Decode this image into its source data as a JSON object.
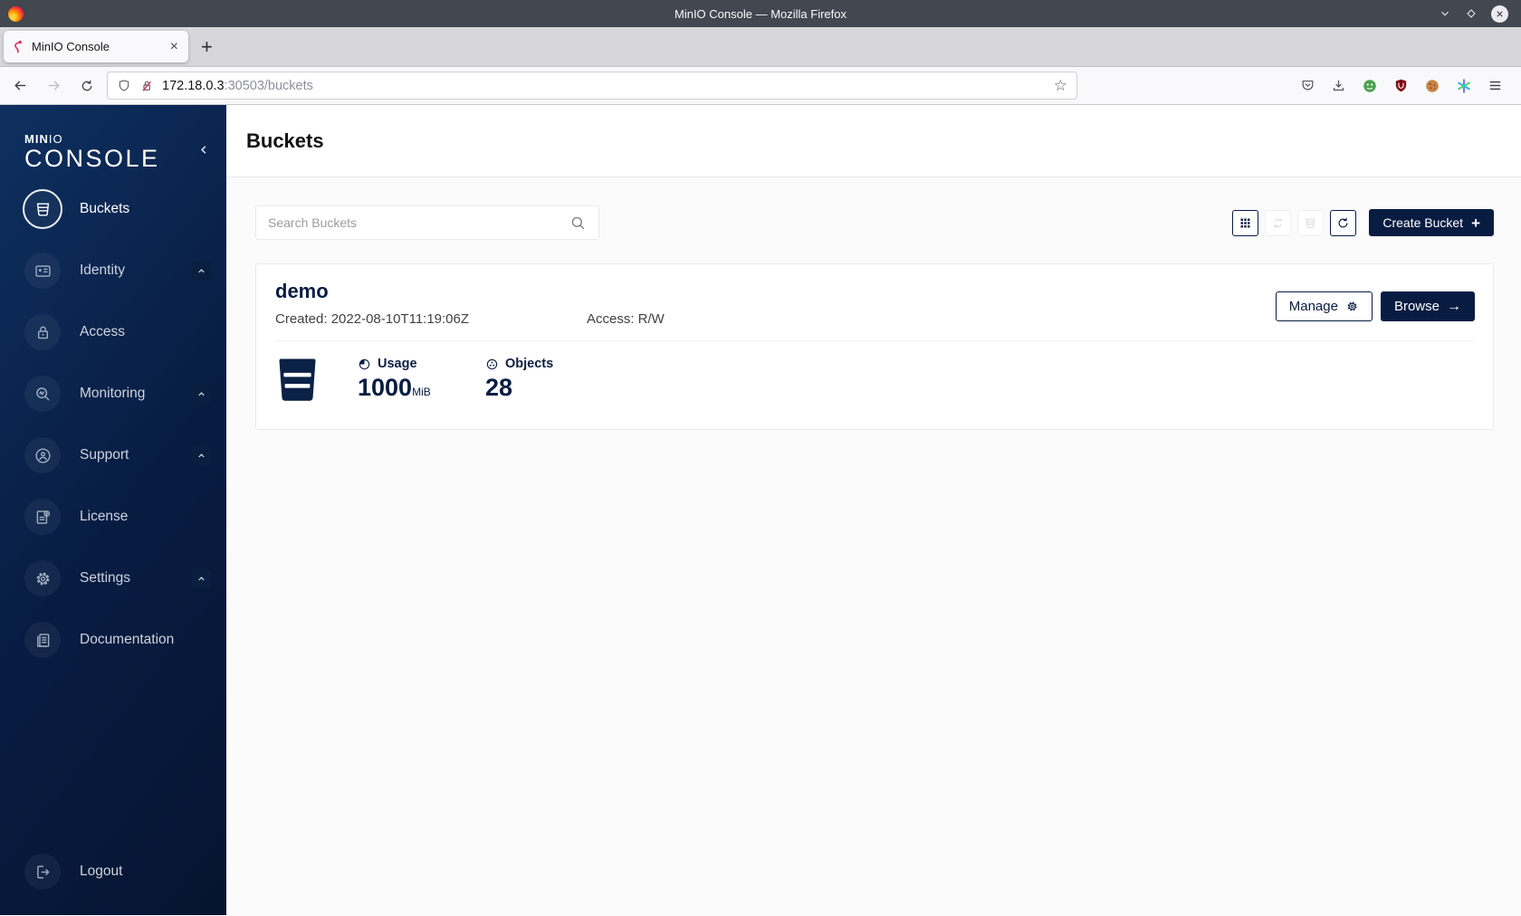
{
  "browser": {
    "window_title": "MinIO Console — Mozilla Firefox",
    "tab_title": "MinIO Console",
    "tab_close": "×",
    "new_tab": "+",
    "url_host": "172.18.0.3",
    "url_rest": ":30503/buckets",
    "bookmark_star": "☆",
    "toolbar_icons": [
      "shield-icon",
      "insecure-lock-icon",
      "pocket-icon",
      "download-icon",
      "privacy-badger-icon",
      "ublock-icon",
      "cookie-icon",
      "snowflake-icon",
      "menu-icon"
    ]
  },
  "sidebar": {
    "logo_top_bold": "MIN",
    "logo_top_light": "IO",
    "logo_bottom": "CONSOLE",
    "items": [
      {
        "label": "Buckets",
        "icon": "bucket-icon",
        "active": true,
        "expandable": false
      },
      {
        "label": "Identity",
        "icon": "id-card-icon",
        "active": false,
        "expandable": true
      },
      {
        "label": "Access",
        "icon": "lock-icon",
        "active": false,
        "expandable": false
      },
      {
        "label": "Monitoring",
        "icon": "monitor-search-icon",
        "active": false,
        "expandable": true
      },
      {
        "label": "Support",
        "icon": "support-icon",
        "active": false,
        "expandable": true
      },
      {
        "label": "License",
        "icon": "license-icon",
        "active": false,
        "expandable": false
      },
      {
        "label": "Settings",
        "icon": "gear-icon",
        "active": false,
        "expandable": true
      },
      {
        "label": "Documentation",
        "icon": "document-icon",
        "active": false,
        "expandable": false
      }
    ],
    "logout_label": "Logout"
  },
  "page": {
    "title": "Buckets",
    "search_placeholder": "Search Buckets",
    "create_button": "Create Bucket",
    "create_plus": "+",
    "view_toolbar_icons": [
      "grid-view-icon",
      "rebalance-icon-disabled",
      "delete-buckets-icon-disabled",
      "refresh-icon"
    ]
  },
  "bucket_card": {
    "name": "demo",
    "created": "Created: 2022-08-10T11:19:06Z",
    "access": "Access: R/W",
    "usage_label": "Usage",
    "usage_value": "1000",
    "usage_unit": "MiB",
    "objects_label": "Objects",
    "objects_value": "28",
    "manage_button": "Manage",
    "browse_button": "Browse",
    "browse_arrow": "→"
  },
  "colors": {
    "minio_navy": "#081c42",
    "sidebar_gradient_start": "#0e3060",
    "sidebar_gradient_end": "#061430",
    "titlebar": "#43474f",
    "toolbar_bg": "#f9f9fb",
    "content_bg": "#fbfbfb",
    "insecure_slash_red": "#e22850"
  }
}
